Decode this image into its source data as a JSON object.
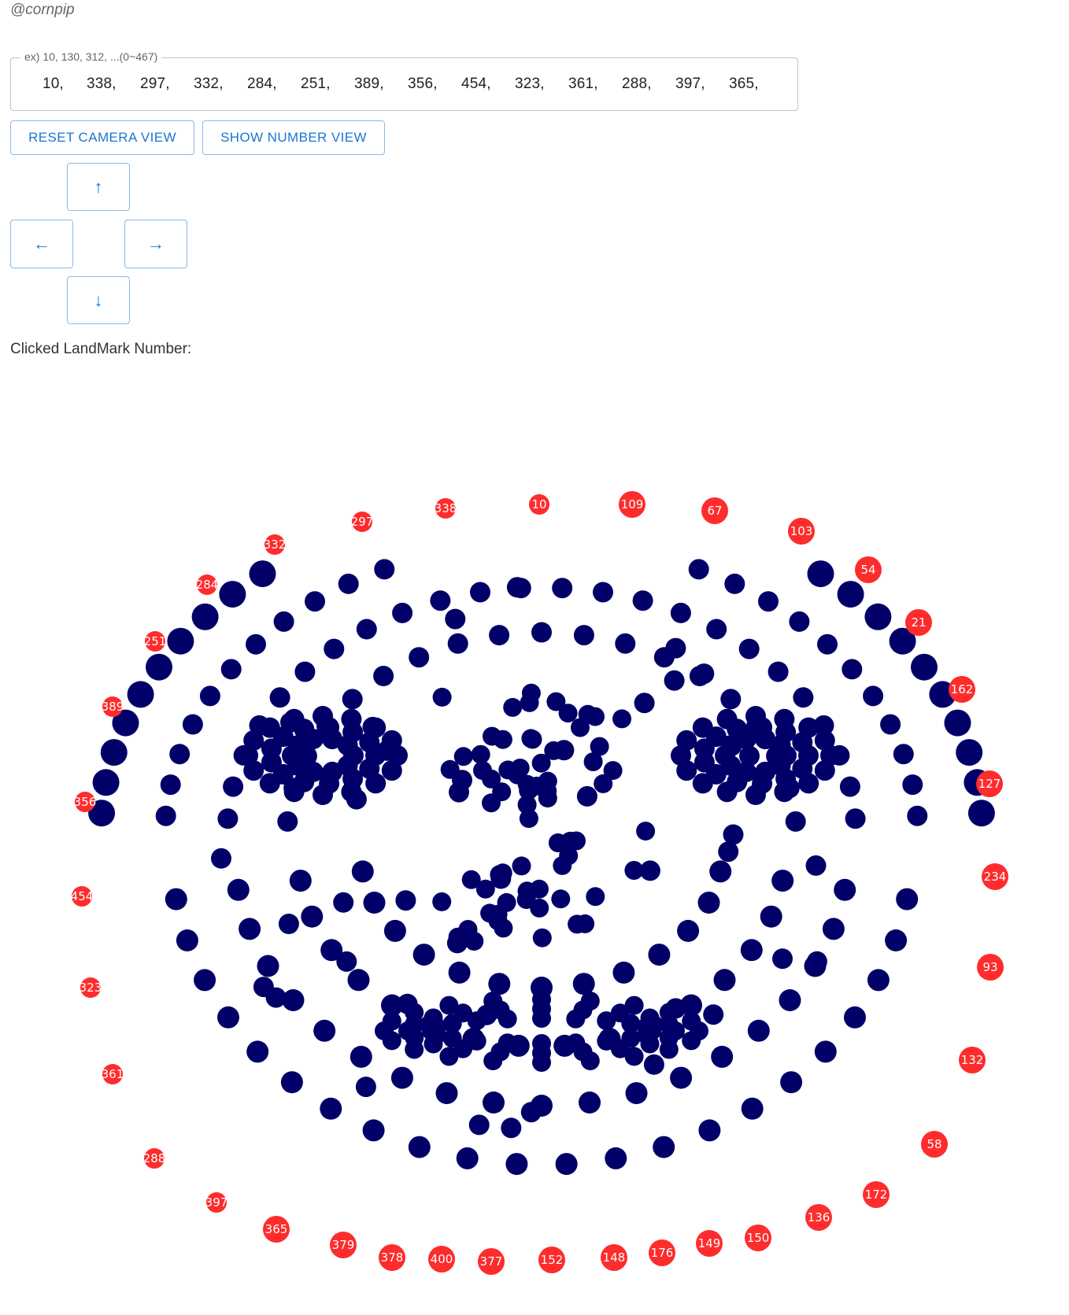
{
  "author": "@cornpip",
  "input": {
    "legend": "ex) 10, 130, 312, ...(0~467)",
    "values": [
      "10,",
      "338,",
      "297,",
      "332,",
      "284,",
      "251,",
      "389,",
      "356,",
      "454,",
      "323,",
      "361,",
      "288,",
      "397,",
      "365,"
    ]
  },
  "buttons": {
    "reset_camera": "RESET CAMERA VIEW",
    "show_number": "SHOW NUMBER VIEW",
    "up": "↑",
    "left": "←",
    "right": "→",
    "down": "↓"
  },
  "clicked_label": "Clicked LandMark Number:",
  "colors": {
    "highlight": "#fe2c2c",
    "landmark": "#000068",
    "accent": "#1976d2"
  },
  "highlighted_landmarks": [
    "10",
    "338",
    "297",
    "332",
    "284",
    "251",
    "389",
    "356",
    "454",
    "323",
    "361",
    "288",
    "397",
    "365",
    "379",
    "378",
    "400",
    "377",
    "152",
    "148",
    "176",
    "149",
    "150",
    "136",
    "172",
    "58",
    "132",
    "93",
    "234",
    "127",
    "162",
    "21",
    "54",
    "103",
    "67",
    "109"
  ]
}
